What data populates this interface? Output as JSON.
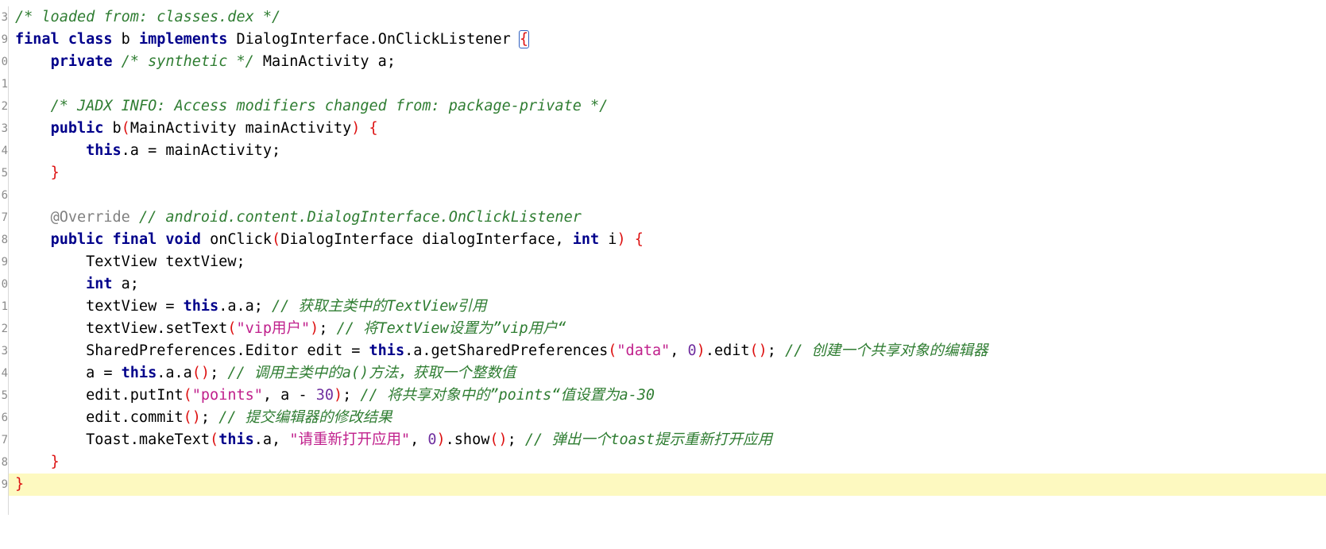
{
  "gutter": {
    "numbers": [
      "3",
      "9",
      "0",
      "1",
      "2",
      "3",
      "4",
      "5",
      "6",
      "7",
      "8",
      "9",
      "0",
      "1",
      "2",
      "3",
      "4",
      "5",
      "6",
      "7",
      "8",
      "9"
    ]
  },
  "code": {
    "l1_comment": "/* loaded from: classes.dex */",
    "l2_final": "final",
    "l2_class": "class",
    "l2_b": " b ",
    "l2_implements": "implements",
    "l2_iface": " DialogInterface.OnClickListener ",
    "l2_brace": "{",
    "l3_private": "private",
    "l3_comment": "/* synthetic */",
    "l3_rest": " MainActivity a;",
    "l5_comment": "/* JADX INFO: Access modifiers changed from: package-private */",
    "l6_public": "public",
    "l6_rest": " b",
    "l6_paren_open": "(",
    "l6_params": "MainActivity mainActivity",
    "l6_paren_close": ")",
    "l6_brace": "{",
    "l7_this": "this",
    "l7_rest": ".a = mainActivity;",
    "l8_brace": "}",
    "l10_annotation": "@Override",
    "l10_comment": "// android.content.DialogInterface.OnClickListener",
    "l11_public": "public",
    "l11_final": "final",
    "l11_void": "void",
    "l11_name": " onClick",
    "l11_paren_open": "(",
    "l11_param1": "DialogInterface dialogInterface, ",
    "l11_int": "int",
    "l11_param2": " i",
    "l11_paren_close": ")",
    "l11_brace": "{",
    "l12_text": "TextView textView;",
    "l13_int": "int",
    "l13_rest": " a;",
    "l14_pre": "textView = ",
    "l14_this": "this",
    "l14_post": ".a.a; ",
    "l14_comment": "// 获取主类中的TextView引用",
    "l15_pre": "textView.setText",
    "l15_paren_open": "(",
    "l15_str": "\"vip用户\"",
    "l15_paren_close": ")",
    "l15_semi": "; ",
    "l15_comment": "// 将TextView设置为”vip用户“",
    "l16_pre": "SharedPreferences.Editor edit = ",
    "l16_this": "this",
    "l16_mid": ".a.getSharedPreferences",
    "l16_paren_open": "(",
    "l16_str": "\"data\"",
    "l16_comma": ", ",
    "l16_num": "0",
    "l16_paren_close": ")",
    "l16_edit": ".edit",
    "l16_paren2": "()",
    "l16_semi": "; ",
    "l16_comment": "// 创建一个共享对象的编辑器",
    "l17_pre": "a = ",
    "l17_this": "this",
    "l17_mid": ".a.a",
    "l17_paren": "()",
    "l17_semi": "; ",
    "l17_comment": "// 调用主类中的a()方法，获取一个整数值",
    "l18_pre": "edit.putInt",
    "l18_paren_open": "(",
    "l18_str": "\"points\"",
    "l18_mid": ", a - ",
    "l18_num": "30",
    "l18_paren_close": ")",
    "l18_semi": "; ",
    "l18_comment": "// 将共享对象中的”points“值设置为a-30",
    "l19_pre": "edit.commit",
    "l19_paren": "()",
    "l19_semi": "; ",
    "l19_comment": "// 提交编辑器的修改结果",
    "l20_pre": "Toast.makeText",
    "l20_paren_open": "(",
    "l20_this": "this",
    "l20_mid": ".a, ",
    "l20_str": "\"请重新打开应用\"",
    "l20_comma": ", ",
    "l20_num": "0",
    "l20_paren_close": ")",
    "l20_show": ".show",
    "l20_paren2": "()",
    "l20_semi": "; ",
    "l20_comment": "// 弹出一个toast提示重新打开应用",
    "l21_brace": "}",
    "l22_brace": "}"
  }
}
